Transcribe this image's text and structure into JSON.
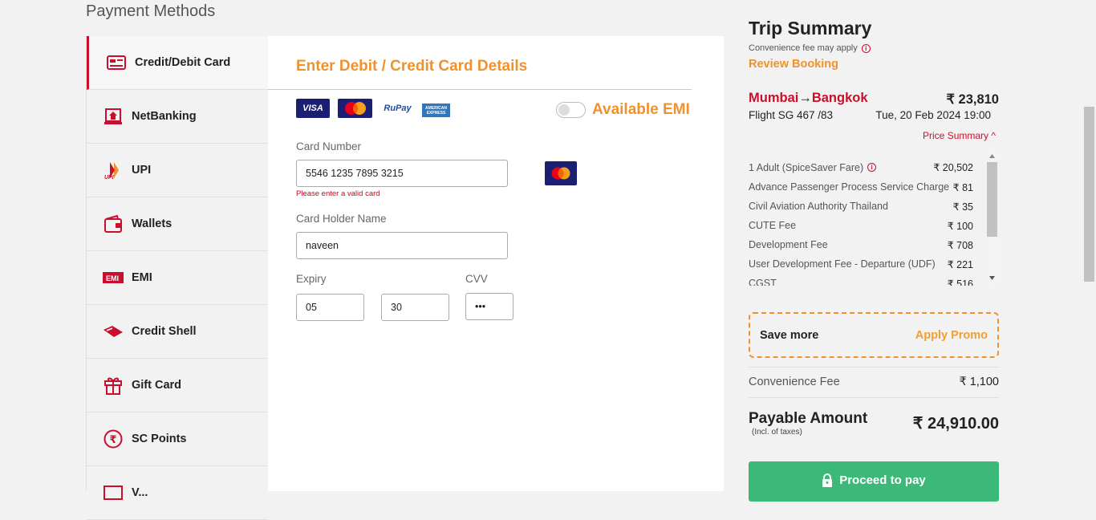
{
  "page": {
    "title": "Payment Methods"
  },
  "nav": {
    "items": [
      {
        "label": "Credit/Debit Card",
        "icon": "card-icon",
        "active": true
      },
      {
        "label": "NetBanking",
        "icon": "bank-icon"
      },
      {
        "label": "UPI",
        "icon": "upi-icon"
      },
      {
        "label": "Wallets",
        "icon": "wallet-icon"
      },
      {
        "label": "EMI",
        "icon": "emi-icon"
      },
      {
        "label": "Credit Shell",
        "icon": "credit-shell-icon"
      },
      {
        "label": "Gift Card",
        "icon": "gift-icon"
      },
      {
        "label": "SC Points",
        "icon": "rupee-points-icon"
      },
      {
        "label": "V...",
        "icon": "voucher-icon"
      }
    ]
  },
  "card_form": {
    "heading": "Enter Debit / Credit Card Details",
    "logos": [
      "VISA",
      "MasterCard",
      "RuPay",
      "AMERICAN EXPRESS"
    ],
    "emi_label": "Available EMI",
    "card_number_label": "Card Number",
    "card_number_value": "5546 1235 7895 3215",
    "card_number_error": "Please enter a valid card",
    "holder_label": "Card Holder Name",
    "holder_value": "naveen",
    "expiry_label": "Expiry",
    "expiry_month": "05",
    "expiry_year": "30",
    "cvv_label": "CVV",
    "cvv_value": "•••"
  },
  "summary": {
    "title": "Trip Summary",
    "convenience_note": "Convenience fee may apply",
    "review_label": "Review Booking",
    "route_from": "Mumbai",
    "route_to": "Bangkok",
    "route_arrow": "→",
    "fare": "₹ 23,810",
    "flight": "Flight  SG 467 /83",
    "date": "Tue, 20 Feb 2024 19:00",
    "price_summary_label": "Price Summary ^",
    "breakdown": [
      {
        "label": "1 Adult  (SpiceSaver Fare)",
        "amount": "₹ 20,502",
        "info": true
      },
      {
        "label": "Advance Passenger Process Service Charge",
        "amount": "₹ 81"
      },
      {
        "label": "Civil Aviation Authority Thailand",
        "amount": "₹ 35"
      },
      {
        "label": "CUTE Fee",
        "amount": "₹ 100"
      },
      {
        "label": "Development Fee",
        "amount": "₹ 708"
      },
      {
        "label": "User Development Fee - Departure (UDF)",
        "amount": "₹ 221"
      },
      {
        "label": "CGST",
        "amount": "₹ 516"
      }
    ],
    "promo_left": "Save more",
    "promo_right": "Apply Promo",
    "fee_label": "Convenience Fee",
    "fee_value": "₹ 1,100",
    "payable_label": "Payable Amount",
    "payable_sub": "(Incl. of taxes)",
    "payable_value": "₹ 24,910.00",
    "proceed_label": "Proceed to pay"
  },
  "colors": {
    "accent_orange": "#f0922b",
    "brand_red": "#c8102e",
    "proceed_green": "#3cb878"
  }
}
